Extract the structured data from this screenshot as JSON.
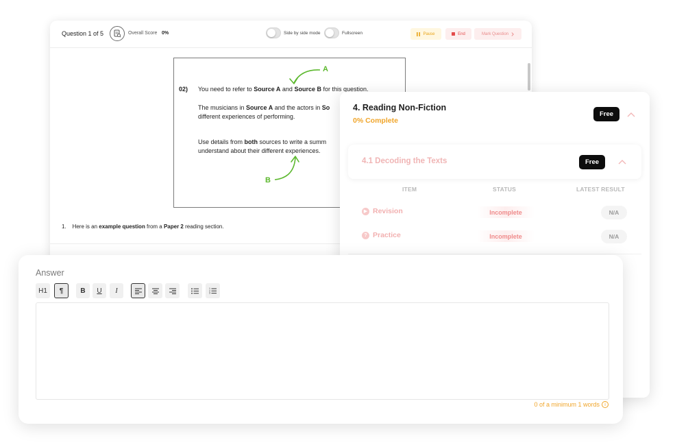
{
  "question_viewer": {
    "question_counter": "Question 1 of 5",
    "overall_score_label": "Overall Score",
    "overall_score_value": "0%",
    "side_by_side_label": "Side by side mode",
    "fullscreen_label": "Fullscreen",
    "pause_label": "Pause",
    "end_label": "End",
    "mark_label": "Mark Question",
    "source": {
      "number": "02)",
      "line1_pre": "You need to refer to ",
      "line1_b1": "Source A",
      "line1_mid": " and ",
      "line1_b2": "Source B",
      "line1_post": " for this question.",
      "line2_pre": "The musicians in ",
      "line2_b1": "Source A",
      "line2_post": " and the actors in ",
      "line2_b2": "So",
      "line3": "different experiences of performing.",
      "line4_pre": "Use details from ",
      "line4_b": "both",
      "line4_post": " sources to write a summ",
      "line5": "understand about their different experiences.",
      "annotation_a": "A",
      "annotation_b": "B"
    },
    "example": {
      "number": "1.",
      "pre": "Here is an ",
      "b1": "example question",
      "mid": " from a ",
      "b2": "Paper 2",
      "post": " reading section."
    }
  },
  "progress": {
    "title": "4. Reading Non-Fiction",
    "complete": "0% Complete",
    "badge": "Free",
    "subsection": {
      "title": "4.1 Decoding the Texts",
      "badge": "Free"
    },
    "columns": [
      "ITEM",
      "STATUS",
      "LATEST RESULT"
    ],
    "rows": [
      {
        "item": "Revision",
        "icon": "play-icon",
        "status": "Incomplete",
        "result": "N/A"
      },
      {
        "item": "Practice",
        "icon": "question-icon",
        "status": "Incomplete",
        "result": "N/A"
      }
    ]
  },
  "answer": {
    "label": "Answer",
    "toolbar": {
      "h1": "H1",
      "paragraph": "¶",
      "bold": "B",
      "underline": "U",
      "italic": "I"
    },
    "word_count": "0 of a minimum 1 words"
  },
  "colors": {
    "accent_orange": "#f0a52a",
    "accent_green": "#5cb82e",
    "accent_red": "#e34b4b",
    "badge_black": "#0d0d0d"
  }
}
